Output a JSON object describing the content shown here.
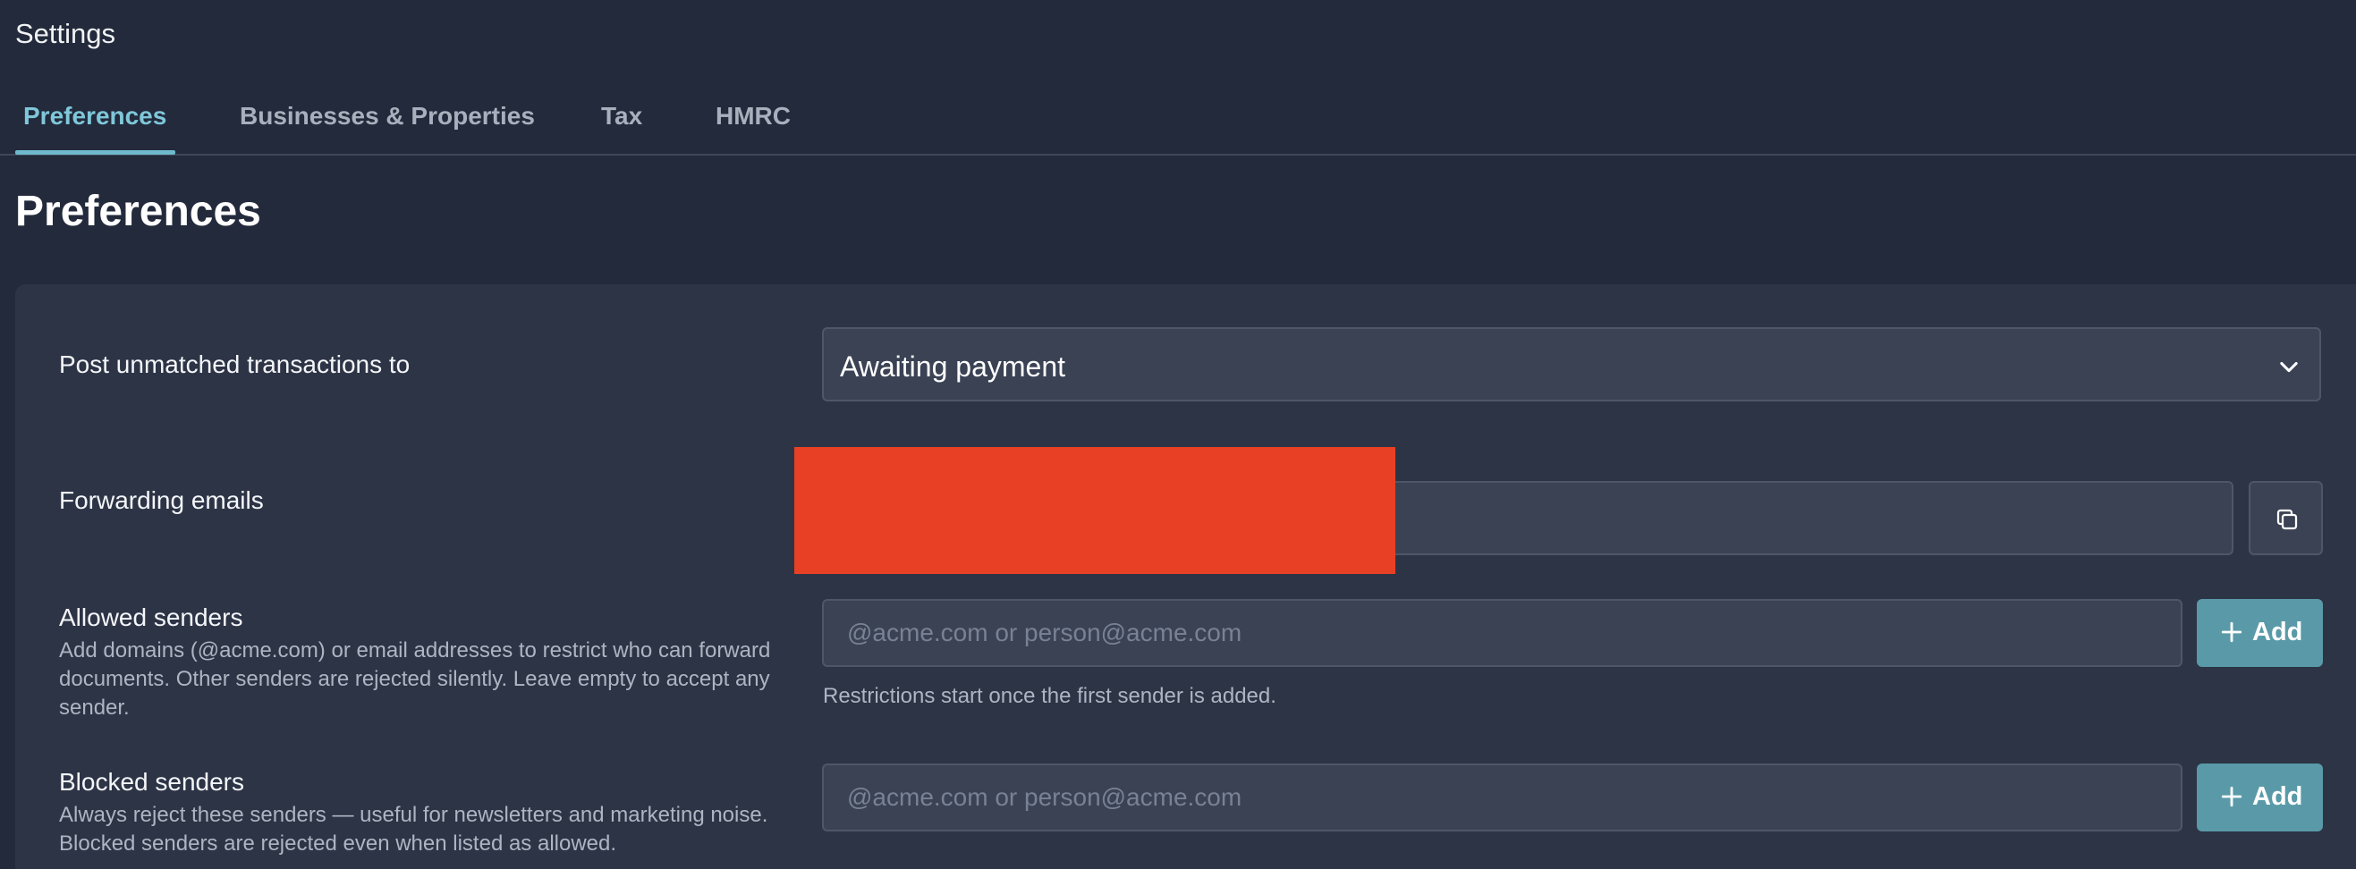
{
  "app": {
    "title": "Settings"
  },
  "tabs": [
    {
      "label": "Preferences",
      "active": true
    },
    {
      "label": "Businesses & Properties",
      "active": false
    },
    {
      "label": "Tax",
      "active": false
    },
    {
      "label": "HMRC",
      "active": false
    }
  ],
  "page": {
    "title": "Preferences"
  },
  "settings": {
    "post_unmatched": {
      "label": "Post unmatched transactions to",
      "selected": "Awaiting payment",
      "icon": "chevron-down-icon"
    },
    "forwarding_emails": {
      "label": "Forwarding emails",
      "copy_icon": "copy-icon",
      "redaction_color": "#e84024"
    },
    "allowed_senders": {
      "title": "Allowed senders",
      "description": "Add domains (@acme.com) or email addresses to restrict who can forward documents. Other senders are rejected silently. Leave empty to accept any sender.",
      "placeholder": "@acme.com or person@acme.com",
      "add_label": "Add",
      "hint": "Restrictions start once the first sender is added."
    },
    "blocked_senders": {
      "title": "Blocked senders",
      "description": "Always reject these senders — useful for newsletters and marketing noise. Blocked senders are rejected even when listed as allowed.",
      "placeholder": "@acme.com or person@acme.com",
      "add_label": "Add"
    }
  },
  "colors": {
    "background": "#232a3b",
    "panel": "#2d3446",
    "accent": "#7fc7da",
    "button": "#5a9aa8"
  }
}
